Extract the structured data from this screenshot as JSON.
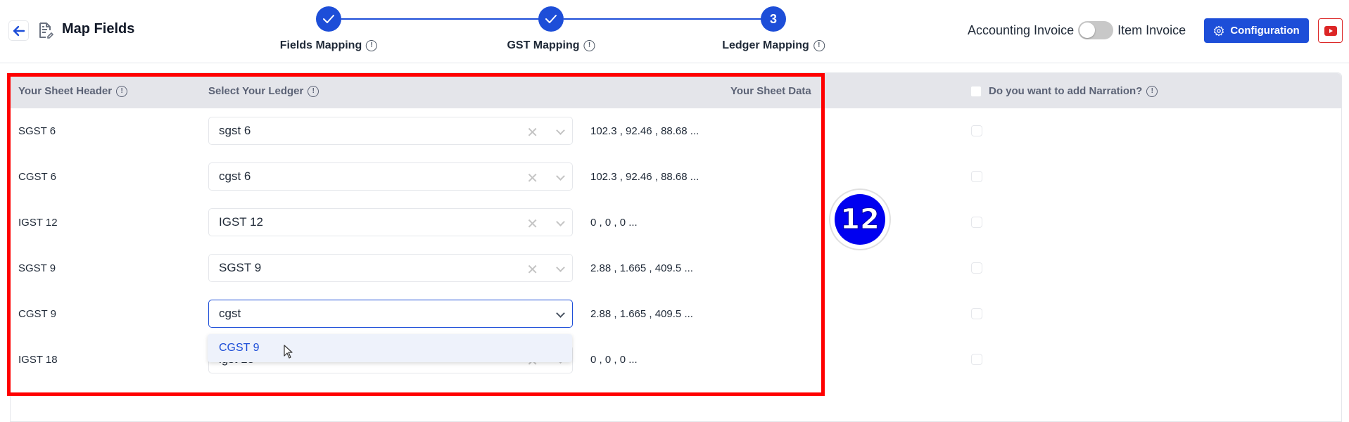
{
  "header": {
    "back_icon": "arrow-left-icon",
    "doc_icon": "document-edit-icon",
    "title": "Map Fields"
  },
  "stepper": {
    "steps": [
      {
        "label": "Fields Mapping",
        "status": "completed",
        "marker": "✓"
      },
      {
        "label": "GST Mapping",
        "status": "completed",
        "marker": "✓"
      },
      {
        "label": "Ledger Mapping",
        "status": "current",
        "marker": "3"
      }
    ],
    "info_glyph": "!"
  },
  "toolbar": {
    "left_toggle_label": "Accounting Invoice",
    "right_toggle_label": "Item Invoice",
    "toggle_state": "off",
    "config_label": "Configuration",
    "config_icon": "gear-icon",
    "youtube_icon": "youtube-icon"
  },
  "table": {
    "columns": {
      "sheet_header": "Your Sheet Header",
      "select_ledger": "Select Your Ledger",
      "sheet_data": "Your Sheet Data",
      "narration": "Do you want to add Narration?"
    },
    "rows": [
      {
        "header": "SGST 6",
        "ledger": "sgst 6",
        "data": "102.3 , 92.46 , 88.68 ..."
      },
      {
        "header": "CGST 6",
        "ledger": "cgst 6",
        "data": "102.3 , 92.46 , 88.68 ..."
      },
      {
        "header": "IGST 12",
        "ledger": "IGST 12",
        "data": "0 , 0 , 0 ..."
      },
      {
        "header": "SGST 9",
        "ledger": "SGST 9",
        "data": "2.88 , 1.665 , 409.5 ..."
      },
      {
        "header": "CGST 9",
        "ledger": "cgst",
        "data": "2.88 , 1.665 , 409.5 ..."
      },
      {
        "header": "IGST 18",
        "ledger": "igst 18",
        "data": "0 , 0 , 0 ..."
      }
    ],
    "dropdown_options": [
      "CGST 9"
    ]
  },
  "annotation": {
    "badge_number": "12",
    "highlight_color": "#ff0000"
  },
  "colors": {
    "primary": "#1d4ed8",
    "youtube": "#dc2626",
    "table_header_bg": "#e4e5ea"
  }
}
